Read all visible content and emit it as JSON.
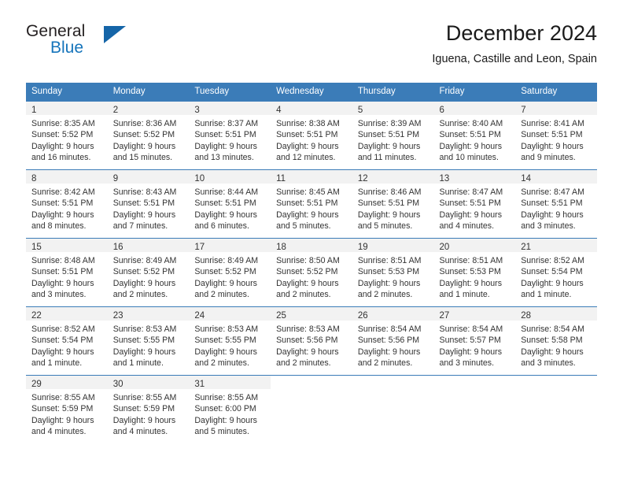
{
  "brand": {
    "name_top": "General",
    "name_bottom": "Blue",
    "triangle_color": "#1565a8",
    "blue_text_color": "#1574bb"
  },
  "header": {
    "title": "December 2024",
    "subtitle": "Iguena, Castille and Leon, Spain"
  },
  "theme": {
    "header_blue": "#3b7cb8",
    "day_band_gray": "#f2f2f2",
    "text_color": "#333333"
  },
  "weekday_headers": [
    "Sunday",
    "Monday",
    "Tuesday",
    "Wednesday",
    "Thursday",
    "Friday",
    "Saturday"
  ],
  "weeks": [
    [
      {
        "day": "1",
        "sunrise": "Sunrise: 8:35 AM",
        "sunset": "Sunset: 5:52 PM",
        "daylight_line1": "Daylight: 9 hours",
        "daylight_line2": "and 16 minutes."
      },
      {
        "day": "2",
        "sunrise": "Sunrise: 8:36 AM",
        "sunset": "Sunset: 5:52 PM",
        "daylight_line1": "Daylight: 9 hours",
        "daylight_line2": "and 15 minutes."
      },
      {
        "day": "3",
        "sunrise": "Sunrise: 8:37 AM",
        "sunset": "Sunset: 5:51 PM",
        "daylight_line1": "Daylight: 9 hours",
        "daylight_line2": "and 13 minutes."
      },
      {
        "day": "4",
        "sunrise": "Sunrise: 8:38 AM",
        "sunset": "Sunset: 5:51 PM",
        "daylight_line1": "Daylight: 9 hours",
        "daylight_line2": "and 12 minutes."
      },
      {
        "day": "5",
        "sunrise": "Sunrise: 8:39 AM",
        "sunset": "Sunset: 5:51 PM",
        "daylight_line1": "Daylight: 9 hours",
        "daylight_line2": "and 11 minutes."
      },
      {
        "day": "6",
        "sunrise": "Sunrise: 8:40 AM",
        "sunset": "Sunset: 5:51 PM",
        "daylight_line1": "Daylight: 9 hours",
        "daylight_line2": "and 10 minutes."
      },
      {
        "day": "7",
        "sunrise": "Sunrise: 8:41 AM",
        "sunset": "Sunset: 5:51 PM",
        "daylight_line1": "Daylight: 9 hours",
        "daylight_line2": "and 9 minutes."
      }
    ],
    [
      {
        "day": "8",
        "sunrise": "Sunrise: 8:42 AM",
        "sunset": "Sunset: 5:51 PM",
        "daylight_line1": "Daylight: 9 hours",
        "daylight_line2": "and 8 minutes."
      },
      {
        "day": "9",
        "sunrise": "Sunrise: 8:43 AM",
        "sunset": "Sunset: 5:51 PM",
        "daylight_line1": "Daylight: 9 hours",
        "daylight_line2": "and 7 minutes."
      },
      {
        "day": "10",
        "sunrise": "Sunrise: 8:44 AM",
        "sunset": "Sunset: 5:51 PM",
        "daylight_line1": "Daylight: 9 hours",
        "daylight_line2": "and 6 minutes."
      },
      {
        "day": "11",
        "sunrise": "Sunrise: 8:45 AM",
        "sunset": "Sunset: 5:51 PM",
        "daylight_line1": "Daylight: 9 hours",
        "daylight_line2": "and 5 minutes."
      },
      {
        "day": "12",
        "sunrise": "Sunrise: 8:46 AM",
        "sunset": "Sunset: 5:51 PM",
        "daylight_line1": "Daylight: 9 hours",
        "daylight_line2": "and 5 minutes."
      },
      {
        "day": "13",
        "sunrise": "Sunrise: 8:47 AM",
        "sunset": "Sunset: 5:51 PM",
        "daylight_line1": "Daylight: 9 hours",
        "daylight_line2": "and 4 minutes."
      },
      {
        "day": "14",
        "sunrise": "Sunrise: 8:47 AM",
        "sunset": "Sunset: 5:51 PM",
        "daylight_line1": "Daylight: 9 hours",
        "daylight_line2": "and 3 minutes."
      }
    ],
    [
      {
        "day": "15",
        "sunrise": "Sunrise: 8:48 AM",
        "sunset": "Sunset: 5:51 PM",
        "daylight_line1": "Daylight: 9 hours",
        "daylight_line2": "and 3 minutes."
      },
      {
        "day": "16",
        "sunrise": "Sunrise: 8:49 AM",
        "sunset": "Sunset: 5:52 PM",
        "daylight_line1": "Daylight: 9 hours",
        "daylight_line2": "and 2 minutes."
      },
      {
        "day": "17",
        "sunrise": "Sunrise: 8:49 AM",
        "sunset": "Sunset: 5:52 PM",
        "daylight_line1": "Daylight: 9 hours",
        "daylight_line2": "and 2 minutes."
      },
      {
        "day": "18",
        "sunrise": "Sunrise: 8:50 AM",
        "sunset": "Sunset: 5:52 PM",
        "daylight_line1": "Daylight: 9 hours",
        "daylight_line2": "and 2 minutes."
      },
      {
        "day": "19",
        "sunrise": "Sunrise: 8:51 AM",
        "sunset": "Sunset: 5:53 PM",
        "daylight_line1": "Daylight: 9 hours",
        "daylight_line2": "and 2 minutes."
      },
      {
        "day": "20",
        "sunrise": "Sunrise: 8:51 AM",
        "sunset": "Sunset: 5:53 PM",
        "daylight_line1": "Daylight: 9 hours",
        "daylight_line2": "and 1 minute."
      },
      {
        "day": "21",
        "sunrise": "Sunrise: 8:52 AM",
        "sunset": "Sunset: 5:54 PM",
        "daylight_line1": "Daylight: 9 hours",
        "daylight_line2": "and 1 minute."
      }
    ],
    [
      {
        "day": "22",
        "sunrise": "Sunrise: 8:52 AM",
        "sunset": "Sunset: 5:54 PM",
        "daylight_line1": "Daylight: 9 hours",
        "daylight_line2": "and 1 minute."
      },
      {
        "day": "23",
        "sunrise": "Sunrise: 8:53 AM",
        "sunset": "Sunset: 5:55 PM",
        "daylight_line1": "Daylight: 9 hours",
        "daylight_line2": "and 1 minute."
      },
      {
        "day": "24",
        "sunrise": "Sunrise: 8:53 AM",
        "sunset": "Sunset: 5:55 PM",
        "daylight_line1": "Daylight: 9 hours",
        "daylight_line2": "and 2 minutes."
      },
      {
        "day": "25",
        "sunrise": "Sunrise: 8:53 AM",
        "sunset": "Sunset: 5:56 PM",
        "daylight_line1": "Daylight: 9 hours",
        "daylight_line2": "and 2 minutes."
      },
      {
        "day": "26",
        "sunrise": "Sunrise: 8:54 AM",
        "sunset": "Sunset: 5:56 PM",
        "daylight_line1": "Daylight: 9 hours",
        "daylight_line2": "and 2 minutes."
      },
      {
        "day": "27",
        "sunrise": "Sunrise: 8:54 AM",
        "sunset": "Sunset: 5:57 PM",
        "daylight_line1": "Daylight: 9 hours",
        "daylight_line2": "and 3 minutes."
      },
      {
        "day": "28",
        "sunrise": "Sunrise: 8:54 AM",
        "sunset": "Sunset: 5:58 PM",
        "daylight_line1": "Daylight: 9 hours",
        "daylight_line2": "and 3 minutes."
      }
    ],
    [
      {
        "day": "29",
        "sunrise": "Sunrise: 8:55 AM",
        "sunset": "Sunset: 5:59 PM",
        "daylight_line1": "Daylight: 9 hours",
        "daylight_line2": "and 4 minutes."
      },
      {
        "day": "30",
        "sunrise": "Sunrise: 8:55 AM",
        "sunset": "Sunset: 5:59 PM",
        "daylight_line1": "Daylight: 9 hours",
        "daylight_line2": "and 4 minutes."
      },
      {
        "day": "31",
        "sunrise": "Sunrise: 8:55 AM",
        "sunset": "Sunset: 6:00 PM",
        "daylight_line1": "Daylight: 9 hours",
        "daylight_line2": "and 5 minutes."
      },
      {
        "day": "",
        "sunrise": "",
        "sunset": "",
        "daylight_line1": "",
        "daylight_line2": ""
      },
      {
        "day": "",
        "sunrise": "",
        "sunset": "",
        "daylight_line1": "",
        "daylight_line2": ""
      },
      {
        "day": "",
        "sunrise": "",
        "sunset": "",
        "daylight_line1": "",
        "daylight_line2": ""
      },
      {
        "day": "",
        "sunrise": "",
        "sunset": "",
        "daylight_line1": "",
        "daylight_line2": ""
      }
    ]
  ]
}
